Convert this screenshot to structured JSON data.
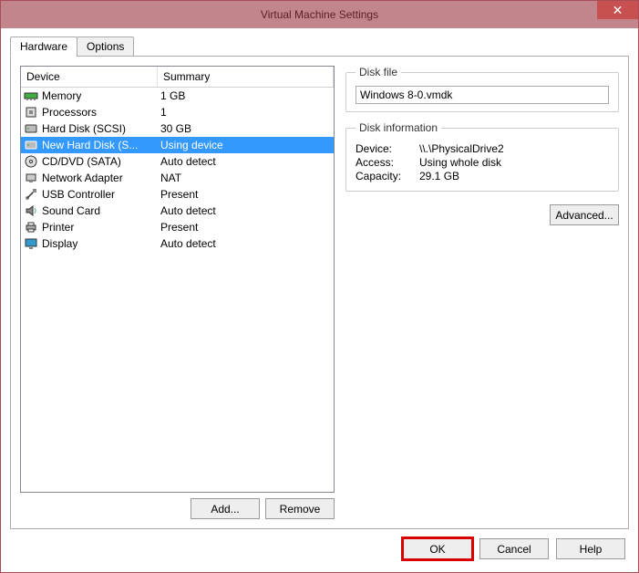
{
  "window": {
    "title": "Virtual Machine Settings"
  },
  "tabs": {
    "hardware": "Hardware",
    "options": "Options"
  },
  "columns": {
    "device": "Device",
    "summary": "Summary"
  },
  "devices": [
    {
      "name": "Memory",
      "summary": "1 GB",
      "icon": "memory"
    },
    {
      "name": "Processors",
      "summary": "1",
      "icon": "cpu"
    },
    {
      "name": "Hard Disk (SCSI)",
      "summary": "30 GB",
      "icon": "hdd"
    },
    {
      "name": "New Hard Disk (S...",
      "summary": "Using device",
      "icon": "hdd"
    },
    {
      "name": "CD/DVD (SATA)",
      "summary": "Auto detect",
      "icon": "cd"
    },
    {
      "name": "Network Adapter",
      "summary": "NAT",
      "icon": "net"
    },
    {
      "name": "USB Controller",
      "summary": "Present",
      "icon": "usb"
    },
    {
      "name": "Sound Card",
      "summary": "Auto detect",
      "icon": "sound"
    },
    {
      "name": "Printer",
      "summary": "Present",
      "icon": "printer"
    },
    {
      "name": "Display",
      "summary": "Auto detect",
      "icon": "display"
    }
  ],
  "selected_index": 3,
  "buttons": {
    "add": "Add...",
    "remove": "Remove",
    "advanced": "Advanced...",
    "ok": "OK",
    "cancel": "Cancel",
    "help": "Help"
  },
  "diskfile": {
    "legend": "Disk file",
    "value": "Windows 8-0.vmdk"
  },
  "diskinfo": {
    "legend": "Disk information",
    "device_label": "Device:",
    "device_value": "\\\\.\\PhysicalDrive2",
    "access_label": "Access:",
    "access_value": "Using whole disk",
    "capacity_label": "Capacity:",
    "capacity_value": "29.1 GB"
  }
}
